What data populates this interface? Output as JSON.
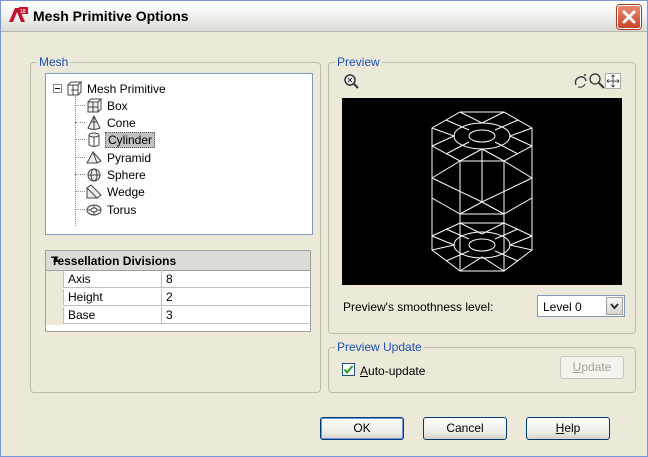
{
  "window": {
    "title": "Mesh Primitive Options"
  },
  "mesh_group": {
    "label": "Mesh",
    "tree": {
      "root": "Mesh Primitive",
      "items": [
        {
          "label": "Box",
          "icon": "box-icon"
        },
        {
          "label": "Cone",
          "icon": "cone-icon"
        },
        {
          "label": "Cylinder",
          "icon": "cylinder-icon",
          "selected": true
        },
        {
          "label": "Pyramid",
          "icon": "pyramid-icon"
        },
        {
          "label": "Sphere",
          "icon": "sphere-icon"
        },
        {
          "label": "Wedge",
          "icon": "wedge-icon"
        },
        {
          "label": "Torus",
          "icon": "torus-icon"
        }
      ]
    },
    "tessellation": {
      "header": "Tessellation Divisions",
      "rows": [
        {
          "key": "Axis",
          "value": "8"
        },
        {
          "key": "Height",
          "value": "2"
        },
        {
          "key": "Base",
          "value": "3"
        }
      ]
    }
  },
  "preview_group": {
    "label": "Preview",
    "smoothness_label": "Preview's smoothness level:",
    "smoothness_value": "Level 0"
  },
  "update_group": {
    "label": "Preview Update",
    "auto_update_label": "Auto-update",
    "auto_update_checked": true,
    "update_button": "Update"
  },
  "buttons": {
    "ok": "OK",
    "cancel": "Cancel",
    "help": "Help"
  },
  "colors": {
    "group_label": "#1c4fb8",
    "preview_bg": "#000000",
    "wireframe": "#ffffff"
  }
}
